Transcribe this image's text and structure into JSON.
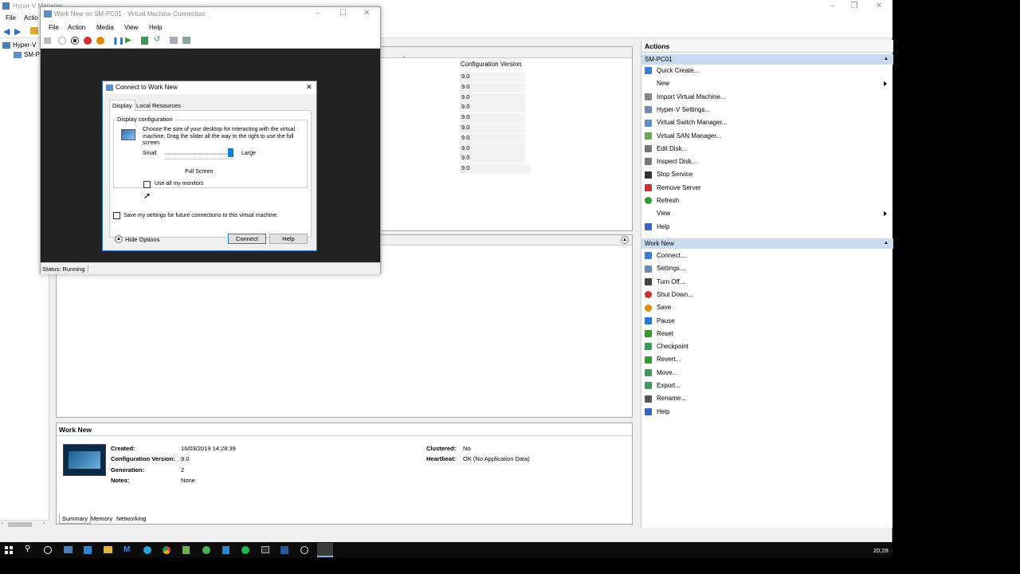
{
  "hyperv": {
    "title": "Hyper-V Manager",
    "menu": [
      "File",
      "Actio"
    ],
    "tree": [
      "Hyper-V",
      "SM-P"
    ]
  },
  "vmlist": {
    "column_header": "Configuration Version",
    "versions": [
      "9.0",
      "9.0",
      "9.0",
      "9.0",
      "9.0",
      "9.0",
      "9.0",
      "9.0",
      "9.0",
      "9.0"
    ]
  },
  "actions": {
    "title": "Actions",
    "server_section": "SM-PC01",
    "server_items": [
      {
        "label": "Quick Create...",
        "icon": "quick-create-icon",
        "color": "#3b7dd8"
      },
      {
        "label": "New",
        "icon": "",
        "color": ""
      },
      {
        "label": "Import Virtual Machine...",
        "icon": "import-icon",
        "color": "#888888"
      },
      {
        "label": "Hyper-V Settings...",
        "icon": "settings-icon",
        "color": "#6a8db5"
      },
      {
        "label": "Virtual Switch Manager...",
        "icon": "switch-icon",
        "color": "#5b8fc9"
      },
      {
        "label": "Virtual SAN Manager...",
        "icon": "san-icon",
        "color": "#6aa84f"
      },
      {
        "label": "Edit Disk...",
        "icon": "disk-icon",
        "color": "#777777"
      },
      {
        "label": "Inspect Disk...",
        "icon": "inspect-disk-icon",
        "color": "#777777"
      },
      {
        "label": "Stop Service",
        "icon": "stop-icon",
        "color": "#333333"
      },
      {
        "label": "Remove Server",
        "icon": "remove-icon",
        "color": "#d32f2f"
      },
      {
        "label": "Refresh",
        "icon": "refresh-icon",
        "color": "#2e9d2e"
      },
      {
        "label": "View",
        "icon": "",
        "color": ""
      },
      {
        "label": "Help",
        "icon": "help-icon",
        "color": "#3b66c4"
      }
    ],
    "vm_section": "Work New",
    "vm_items": [
      {
        "label": "Connect...",
        "icon": "connect-icon",
        "color": "#3b7dd8"
      },
      {
        "label": "Settings...",
        "icon": "settings-icon",
        "color": "#6a8db5"
      },
      {
        "label": "Turn Off...",
        "icon": "turn-off-icon",
        "color": "#444444"
      },
      {
        "label": "Shut Down...",
        "icon": "shutdown-icon",
        "color": "#d32f2f"
      },
      {
        "label": "Save",
        "icon": "save-icon",
        "color": "#e08a00"
      },
      {
        "label": "Pause",
        "icon": "pause-icon",
        "color": "#1f7ad6"
      },
      {
        "label": "Reset",
        "icon": "reset-icon",
        "color": "#2e9d2e"
      },
      {
        "label": "Checkpoint",
        "icon": "checkpoint-icon",
        "color": "#3b9a57"
      },
      {
        "label": "Revert...",
        "icon": "revert-icon",
        "color": "#2e9d2e"
      },
      {
        "label": "Move...",
        "icon": "move-icon",
        "color": "#3b9a57"
      },
      {
        "label": "Export...",
        "icon": "export-icon",
        "color": "#3b9a57"
      },
      {
        "label": "Rename...",
        "icon": "rename-icon",
        "color": "#555555"
      },
      {
        "label": "Help",
        "icon": "help-icon",
        "color": "#3b66c4"
      }
    ]
  },
  "details": {
    "title": "Work New",
    "created_label": "Created:",
    "created": "16/03/2019 14:28:39",
    "config_label": "Configuration Version:",
    "config": "9.0",
    "generation_label": "Generation:",
    "generation": "2",
    "notes_label": "Notes:",
    "notes": "None",
    "clustered_label": "Clustered:",
    "clustered": "No",
    "heartbeat_label": "Heartbeat:",
    "heartbeat": "OK (No Application Data)",
    "tabs": [
      "Summary",
      "Memory",
      "Networking"
    ]
  },
  "vmconnect": {
    "title": "Work New on SM-PC01 - Virtual Machine Connection",
    "menu": [
      "File",
      "Action",
      "Media",
      "View",
      "Help"
    ],
    "status": "Status: Running"
  },
  "dialog": {
    "title": "Connect to Work New",
    "tabs": [
      "Display",
      "Local Resources"
    ],
    "group_label": "Display configuration",
    "description": "Choose the size of your desktop for interacting with the virtual machine. Drag the slider all the way to the right to use the full screen.",
    "small": "Small",
    "large": "Large",
    "slider_value": 1.0,
    "full_screen": "Full Screen",
    "use_all_monitors": "Use all my monitors",
    "save_settings": "Save my settings for future connections to this virtual machine.",
    "hide_options": "Hide Options",
    "connect": "Connect",
    "help": "Help"
  },
  "taskbar": {
    "clock": "20:28"
  },
  "colors": {
    "accent": "#2f7bd1",
    "section_bg": "#c9dcef",
    "taskbar": "#0c0c0c"
  }
}
